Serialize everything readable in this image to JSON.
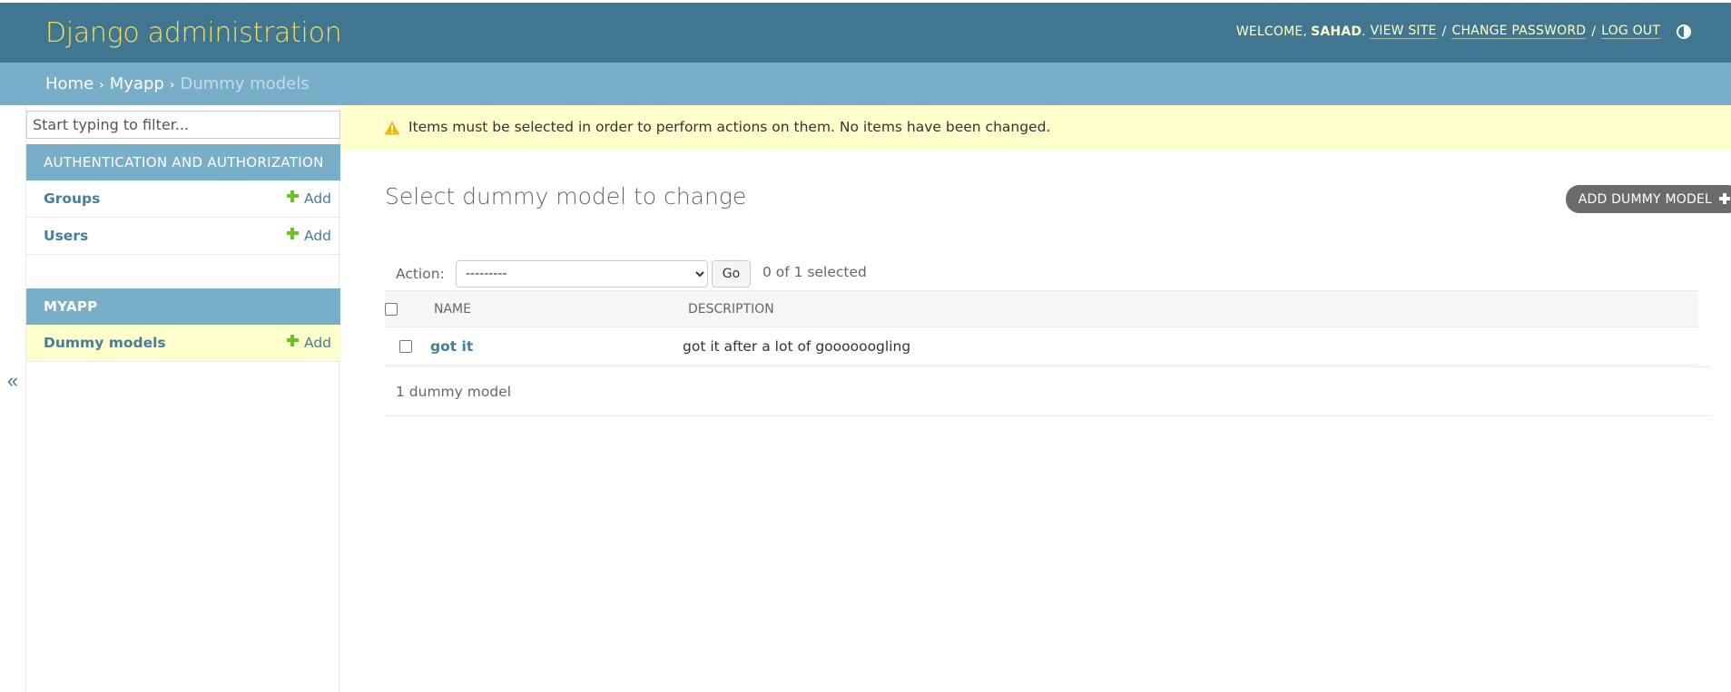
{
  "header": {
    "branding": "Django administration",
    "welcome_text": "Welcome,",
    "username": "Sahad",
    "view_site": "View site",
    "change_password": "Change password",
    "log_out": "Log out",
    "separator": "/",
    "theme_icon": "contrast-half-circle-icon"
  },
  "breadcrumbs": {
    "home": "Home",
    "app": "Myapp",
    "current": "Dummy models",
    "separator": "›"
  },
  "sidebar": {
    "filter_placeholder": "Start typing to filter...",
    "collapse_label": "«",
    "modules": [
      {
        "caption": "Authentication and Authorization",
        "models": [
          {
            "name": "Groups",
            "add": "Add"
          },
          {
            "name": "Users",
            "add": "Add"
          }
        ]
      },
      {
        "caption": "Myapp",
        "models": [
          {
            "name": "Dummy models",
            "add": "Add",
            "current": true
          }
        ]
      }
    ]
  },
  "message": {
    "type": "warning",
    "text": "Items must be selected in order to perform actions on them. No items have been changed."
  },
  "main": {
    "title": "Select dummy model to change",
    "add_button": "Add dummy model",
    "actions": {
      "label": "Action:",
      "select_value": "---------",
      "go_button": "Go",
      "selected_count": "0 of 1 selected"
    },
    "table": {
      "columns": [
        "Name",
        "Description"
      ],
      "rows": [
        {
          "name": "got it",
          "description": "got it after a lot of goooooogling"
        }
      ]
    },
    "paginator": "1 dummy model"
  },
  "colors": {
    "header_bg": "#417690",
    "branding": "#f5dd5d",
    "breadcrumbs_bg": "#79aec8",
    "link": "#447e9b",
    "add_icon": "#70bf2b",
    "warning_bg": "#ffffcc",
    "warning_icon": "#efb80b"
  }
}
